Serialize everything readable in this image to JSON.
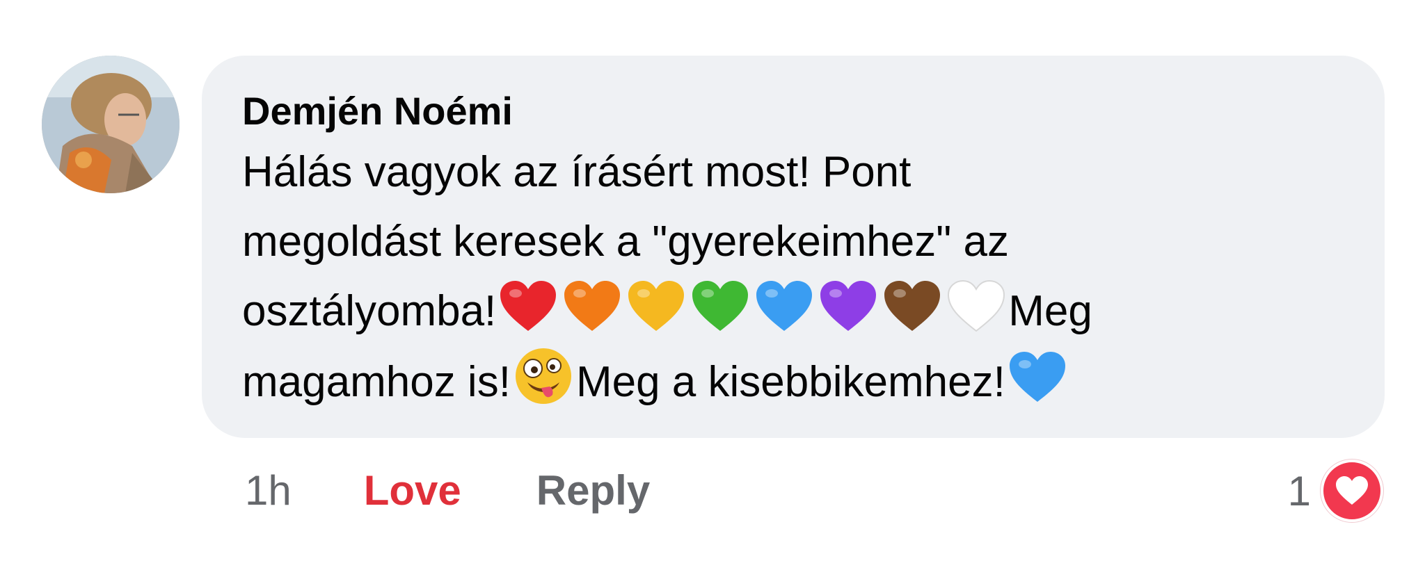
{
  "comment": {
    "author": "Demjén Noémi",
    "text_lines": [
      "Hálás vagyok az írásért most! Pont",
      "megoldást keresek a \"gyerekeimhez\" az",
      "osztályomba!",
      "Meg",
      "magamhoz is!",
      "Meg a kisebbikemhez!"
    ],
    "heart_colors": [
      "#e8252c",
      "#f27a16",
      "#f5b820",
      "#3fb833",
      "#3a9df2",
      "#8e3ee6",
      "#7a4a24",
      "#ffffff"
    ],
    "trailing_heart_color": "#3a9df2",
    "emoji_icon": "zany-face-icon"
  },
  "actions": {
    "time": "1h",
    "love_label": "Love",
    "reply_label": "Reply"
  },
  "reactions": {
    "count": "1",
    "icon": "love-reaction-icon",
    "color": "#f2384f"
  }
}
